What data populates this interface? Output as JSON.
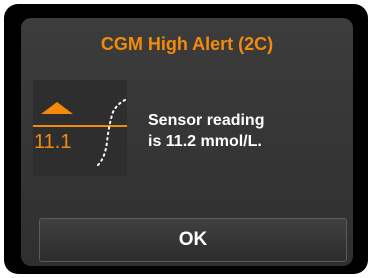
{
  "alert": {
    "title": "CGM High Alert (2C)",
    "glucose_threshold": "11.1",
    "message_line1": "Sensor reading",
    "message_line2": "is 11.2 mmol/L.",
    "icon": "high-glucose-trend-icon",
    "ok_label": "OK"
  },
  "colors": {
    "accent": "#f28b0c",
    "text": "#ffffff",
    "background": "#363636",
    "frame": "#000000"
  }
}
